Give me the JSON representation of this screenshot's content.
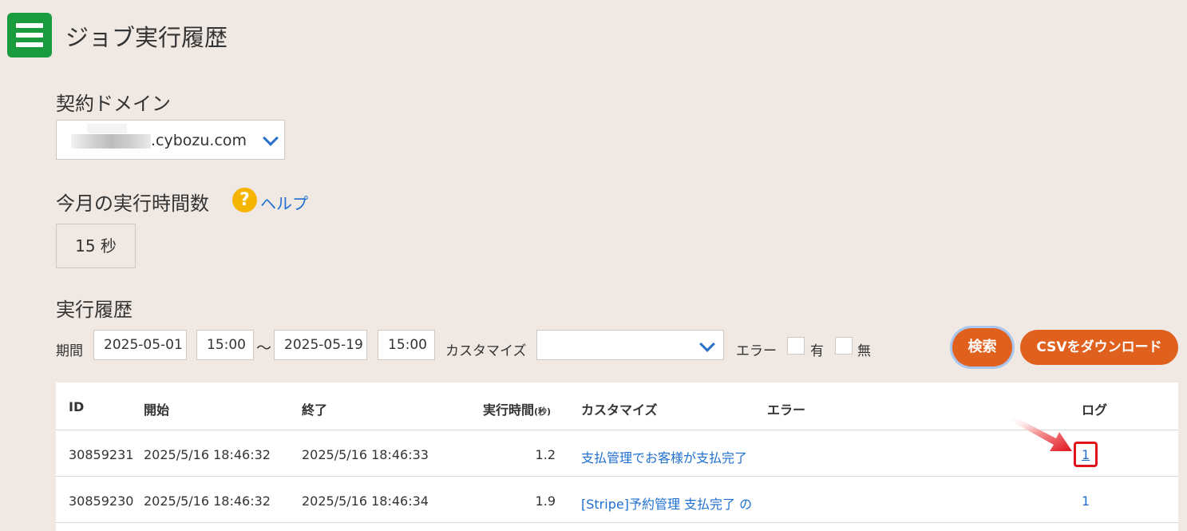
{
  "header": {
    "title": "ジョブ実行履歴"
  },
  "domain": {
    "label": "契約ドメイン",
    "value": ".cybozu.com"
  },
  "usage": {
    "label": "今月の実行時間数",
    "help_label": "ヘルプ",
    "value": "15 秒"
  },
  "history": {
    "label": "実行履歴",
    "filters": {
      "period_label": "期間",
      "start_date": "2025-05-01",
      "start_time": "15:00",
      "separator": "～",
      "end_date": "2025-05-19",
      "end_time": "15:00",
      "customize_label": "カスタマイズ",
      "customize_value": "",
      "error_label": "エラー",
      "error_yes": "有",
      "error_no": "無"
    },
    "search_label": "検索",
    "csv_label": "CSVをダウンロード"
  },
  "table": {
    "headers": {
      "id": "ID",
      "start": "開始",
      "end": "終了",
      "duration": "実行時間",
      "duration_unit": "(秒)",
      "customize": "カスタマイズ",
      "error": "エラー",
      "log": "ログ"
    },
    "rows": [
      {
        "id": "30859231",
        "start": "2025/5/16 18:46:32",
        "end": "2025/5/16 18:46:33",
        "duration": "1.2",
        "customize": "支払管理でお客様が支払完了",
        "error": "",
        "log": "1"
      },
      {
        "id": "30859230",
        "start": "2025/5/16 18:46:32",
        "end": "2025/5/16 18:46:34",
        "duration": "1.9",
        "customize": "[Stripe]予約管理 支払完了 の",
        "error": "",
        "log": "1"
      }
    ]
  },
  "colors": {
    "menu": "#1a9b3f",
    "accent": "#e0601e",
    "link": "#1f6fd1",
    "highlight": "#e0131a"
  }
}
